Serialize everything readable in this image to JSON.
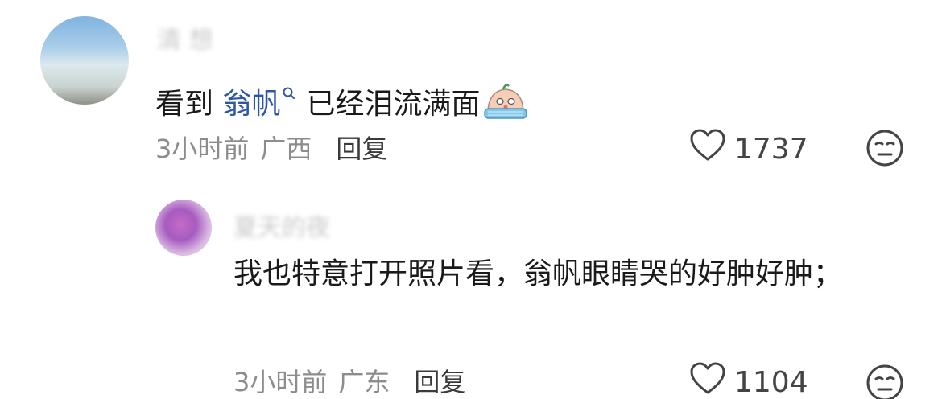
{
  "comment": {
    "username": "清 想",
    "text_before": "看到 ",
    "mention": "翁帆",
    "text_after": "已经泪流满面",
    "time": "3小时前",
    "location": "广西",
    "reply_label": "回复",
    "likes": "1737"
  },
  "reply": {
    "username": "夏天的夜",
    "text": "我也特意打开照片看，翁帆眼睛哭的好肿好肿；",
    "time": "3小时前",
    "location": "广东",
    "reply_label": "回复",
    "likes": "1104"
  },
  "colors": {
    "mention": "#2f57a8",
    "meta": "#8c8c8c",
    "text": "#1a1a1a"
  },
  "icons": {
    "like": "heart-outline-icon",
    "dislike": "meh-face-icon",
    "emoji": "crying-face-emoji",
    "mention": "search-icon"
  }
}
